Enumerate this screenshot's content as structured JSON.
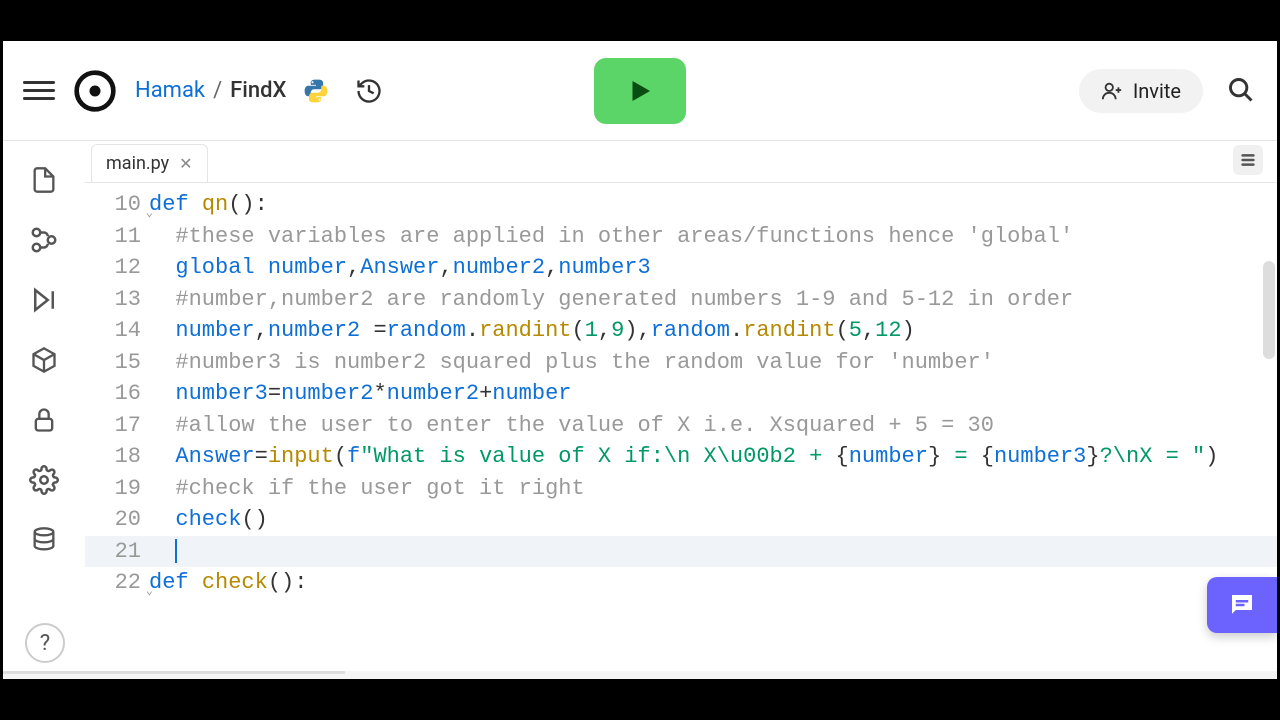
{
  "header": {
    "owner": "Hamak",
    "separator": "/",
    "project": "FindX"
  },
  "invite_label": "Invite",
  "tab": {
    "filename": "main.py"
  },
  "code_lines": [
    {
      "n": 10,
      "fold": true
    },
    {
      "n": 11
    },
    {
      "n": 12
    },
    {
      "n": 13
    },
    {
      "n": 14
    },
    {
      "n": 15
    },
    {
      "n": 16
    },
    {
      "n": 17
    },
    {
      "n": 18
    },
    {
      "n": 19
    },
    {
      "n": 20
    },
    {
      "n": 21,
      "current": true
    },
    {
      "n": 22,
      "fold": true
    }
  ],
  "tokens": {
    "l10": {
      "def": "def ",
      "name": "qn",
      "rest": "():"
    },
    "l11": "  #these variables are applied in other areas/functions hence 'global'",
    "l12": {
      "kw": "  global ",
      "a": "number",
      "c1": ",",
      "b": "Answer",
      "c2": ",",
      "c": "number2",
      "c3": ",",
      "d": "number3"
    },
    "l13": "  #number,number2 are randomly generated numbers 1-9 and 5-12 in order",
    "l14": {
      "a": "  number",
      "c1": ",",
      "b": "number2",
      "eq": " =",
      "r1": "random",
      "dot1": ".",
      "f1": "randint",
      "p1": "(",
      "n1": "1",
      "cm1": ",",
      "n2": "9",
      "p2": "),",
      "r2": "random",
      "dot2": ".",
      "f2": "randint",
      "p3": "(",
      "n3": "5",
      "cm2": ",",
      "n4": "12",
      "p4": ")"
    },
    "l15": "  #number3 is number2 squared plus the random value for 'number'",
    "l16": {
      "a": "  number3",
      "eq": "=",
      "b": "number2",
      "op": "*",
      "c": "number2",
      "plus": "+",
      "d": "number"
    },
    "l17": "  #allow the user to enter the value of X i.e. Xsquared + 5 = 30",
    "l18": {
      "a": "  Answer",
      "eq": "=",
      "fn": "input",
      "p1": "(",
      "fpre": "f",
      "s1": "\"What is value of X if:\\n X\\u00b2 + ",
      "br1": "{",
      "v1": "number",
      "br2": "}",
      "s2": " = ",
      "br3": "{",
      "v2": "number3",
      "br4": "}",
      "s3": "?\\nX = \"",
      "p2": ")"
    },
    "l19": "  #check if the user got it right",
    "l20": {
      "fn": "  check",
      "rest": "()"
    },
    "l22": {
      "def": "def ",
      "name": "check",
      "rest": "():"
    }
  }
}
